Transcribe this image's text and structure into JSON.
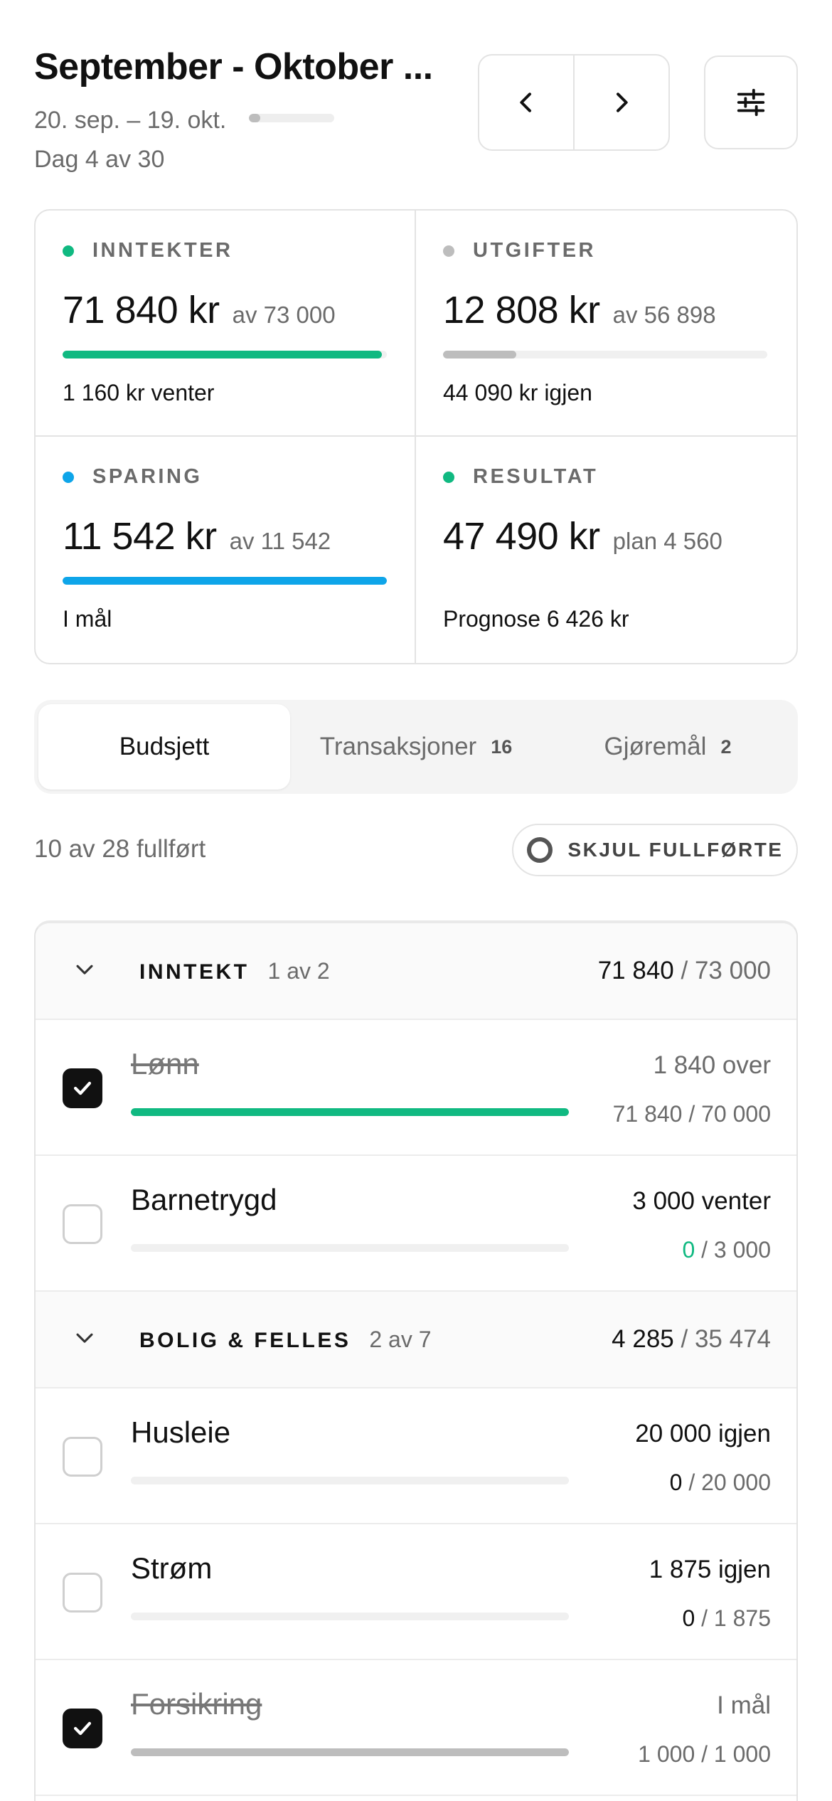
{
  "header": {
    "title": "September - Oktober ...",
    "date_range": "20. sep. – 19. okt.",
    "period_progress": 0.13,
    "day_label": "Dag 4 av 30"
  },
  "colors": {
    "green": "#10b981",
    "blue": "#0ea5e9",
    "gray": "#bdbdbd"
  },
  "stats": [
    {
      "label": "INNTEKTER",
      "amount": "71 840 kr",
      "sub": "av 73 000",
      "progress": 0.984,
      "note": "1 160 kr venter",
      "color": "#10b981",
      "bar_color": "#10b981"
    },
    {
      "label": "UTGIFTER",
      "amount": "12 808 kr",
      "sub": "av 56 898",
      "progress": 0.225,
      "note": "44 090 kr igjen",
      "color": "#bdbdbd",
      "bar_color": "#bdbdbd"
    },
    {
      "label": "SPARING",
      "amount": "11 542 kr",
      "sub": "av 11 542",
      "progress": 1.0,
      "note": "I mål",
      "color": "#0ea5e9",
      "bar_color": "#0ea5e9"
    },
    {
      "label": "RESULTAT",
      "amount": "47 490 kr",
      "sub": "plan 4 560",
      "progress": null,
      "note": "Prognose 6 426 kr",
      "color": "#10b981",
      "bar_color": ""
    }
  ],
  "tabs": [
    {
      "label": "Budsjett",
      "count": "",
      "active": true
    },
    {
      "label": "Transaksjoner",
      "count": "16",
      "active": false
    },
    {
      "label": "Gjøremål",
      "count": "2",
      "active": false
    }
  ],
  "progress": {
    "completed_label": "10 av 28 fullført",
    "hide_completed_label": "SKJUL FULLFØRTE"
  },
  "groups": [
    {
      "name": "INNTEKT",
      "count": "1 av 2",
      "current": "71 840",
      "total": "/ 73 000",
      "items": [
        {
          "name": "Lønn",
          "checked": true,
          "status": "1 840 over",
          "status_muted": true,
          "current": "71 840",
          "total": "/ 70 000",
          "progress": 1.0,
          "bar_color": "#10b981",
          "current_style": "muted"
        },
        {
          "name": "Barnetrygd",
          "checked": false,
          "status": "3 000 venter",
          "status_muted": false,
          "current": "0",
          "total": "/ 3 000",
          "progress": 0,
          "bar_color": "#10b981",
          "current_style": "green"
        }
      ]
    },
    {
      "name": "BOLIG & FELLES",
      "count": "2 av 7",
      "current": "4 285",
      "total": "/ 35 474",
      "items": [
        {
          "name": "Husleie",
          "checked": false,
          "status": "20 000 igjen",
          "status_muted": false,
          "current": "0",
          "total": "/ 20 000",
          "progress": 0,
          "bar_color": "#bdbdbd",
          "current_style": "dark"
        },
        {
          "name": "Strøm",
          "checked": false,
          "status": "1 875 igjen",
          "status_muted": false,
          "current": "0",
          "total": "/ 1 875",
          "progress": 0,
          "bar_color": "#bdbdbd",
          "current_style": "dark"
        },
        {
          "name": "Forsikring",
          "checked": true,
          "status": "I mål",
          "status_muted": true,
          "current": "1 000",
          "total": "/ 1 000",
          "progress": 1.0,
          "bar_color": "#bdbdbd",
          "current_style": "muted"
        }
      ]
    }
  ]
}
